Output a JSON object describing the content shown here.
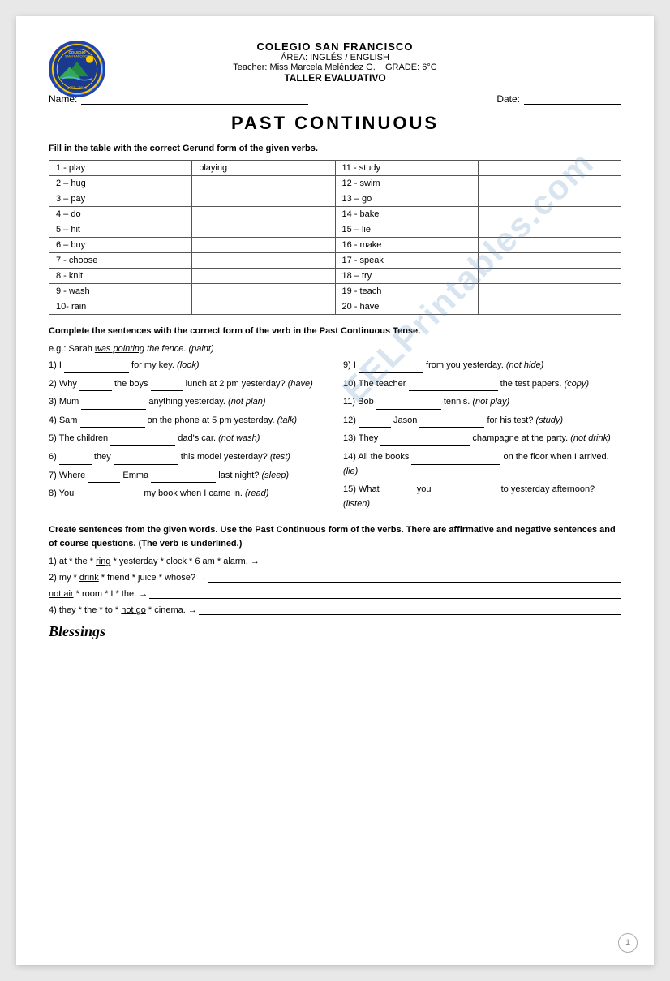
{
  "header": {
    "school_name": "COLEGIO SAN FRANCISCO",
    "area": "ÁREA: INGLÉS / ENGLISH",
    "teacher": "Teacher: Miss Marcela Meléndez G.",
    "grade": "GRADE: 6°C",
    "taller": "TALLER EVALUATIVO"
  },
  "name_label": "Name:",
  "date_label": "Date:",
  "main_title": "PAST CONTINUOUS",
  "section1_instruction": "Fill in the table with the correct Gerund form of the given verbs.",
  "verb_table": {
    "rows": [
      {
        "left_num": "1 - play",
        "left_ans": "playing",
        "right_num": "11 - study",
        "right_ans": ""
      },
      {
        "left_num": "2 – hug",
        "left_ans": "",
        "right_num": "12 - swim",
        "right_ans": ""
      },
      {
        "left_num": "3 – pay",
        "left_ans": "",
        "right_num": "13 – go",
        "right_ans": ""
      },
      {
        "left_num": "4 – do",
        "left_ans": "",
        "right_num": "14 - bake",
        "right_ans": ""
      },
      {
        "left_num": "5 – hit",
        "left_ans": "",
        "right_num": "15 – lie",
        "right_ans": ""
      },
      {
        "left_num": "6 – buy",
        "left_ans": "",
        "right_num": "16 - make",
        "right_ans": ""
      },
      {
        "left_num": "7 - choose",
        "left_ans": "",
        "right_num": "17 - speak",
        "right_ans": ""
      },
      {
        "left_num": "8 - knit",
        "left_ans": "",
        "right_num": "18 – try",
        "right_ans": ""
      },
      {
        "left_num": "9 - wash",
        "left_ans": "",
        "right_num": "19 - teach",
        "right_ans": ""
      },
      {
        "left_num": "10- rain",
        "left_ans": "",
        "right_num": "20 - have",
        "right_ans": ""
      }
    ]
  },
  "section2_instruction": "Complete the sentences with the correct form of the verb in the Past Continuous Tense.",
  "example": "e.g.: Sarah was pointing the fence. (paint)",
  "sentences_left": [
    {
      "num": "1)",
      "text": "I _______________ for my key. (look)"
    },
    {
      "num": "2)",
      "text": "Why ______ the boys __________ lunch at 2 pm yesterday? (have)"
    },
    {
      "num": "3)",
      "text": "Mum _______________ anything yesterday. (not plan)"
    },
    {
      "num": "4)",
      "text": "Sam _______________ on the phone at 5 pm yesterday. (talk)"
    },
    {
      "num": "5)",
      "text": "The children _______________ dad's car. (not wash)"
    },
    {
      "num": "6)",
      "text": "______ they _______________ this model yesterday? (test)"
    },
    {
      "num": "7)",
      "text": "Where ______ Emma _______________ last night? (sleep)"
    },
    {
      "num": "8)",
      "text": "You _______________ my book when I came in. (read)"
    }
  ],
  "sentences_right": [
    {
      "num": "9)",
      "text": "I _______________ from you yesterday. (not hide)"
    },
    {
      "num": "10)",
      "text": "The teacher _______________ the test papers. (copy)"
    },
    {
      "num": "11)",
      "text": "Bob _______________ tennis. (not play)"
    },
    {
      "num": "12)",
      "text": "_____ Jason _______________ for his test? (study)"
    },
    {
      "num": "13)",
      "text": "They _______________ champagne at the party. (not drink)"
    },
    {
      "num": "14)",
      "text": "All the books _______________ on the floor when I arrived. (lie)"
    },
    {
      "num": "15)",
      "text": "What ______ you _______________ to yesterday afternoon? (listen)"
    }
  ],
  "section3_instruction": "Create sentences from the given words. Use the Past Continuous form of the verbs. There are affirmative and negative sentences and of course questions. (The verb is underlined.)",
  "create_items": [
    {
      "text": "1) at * the * ring * yesterday * clock * 6 am * alarm. →"
    },
    {
      "text": "2) my * drink * friend * juice * whose? →"
    },
    {
      "text": "3) not air * room * I * the. →"
    },
    {
      "text": "4) they * the * to * not go * cinema. →"
    }
  ],
  "blessings": "Blessings",
  "page_number": "1",
  "watermark": "EELPrintables.com"
}
